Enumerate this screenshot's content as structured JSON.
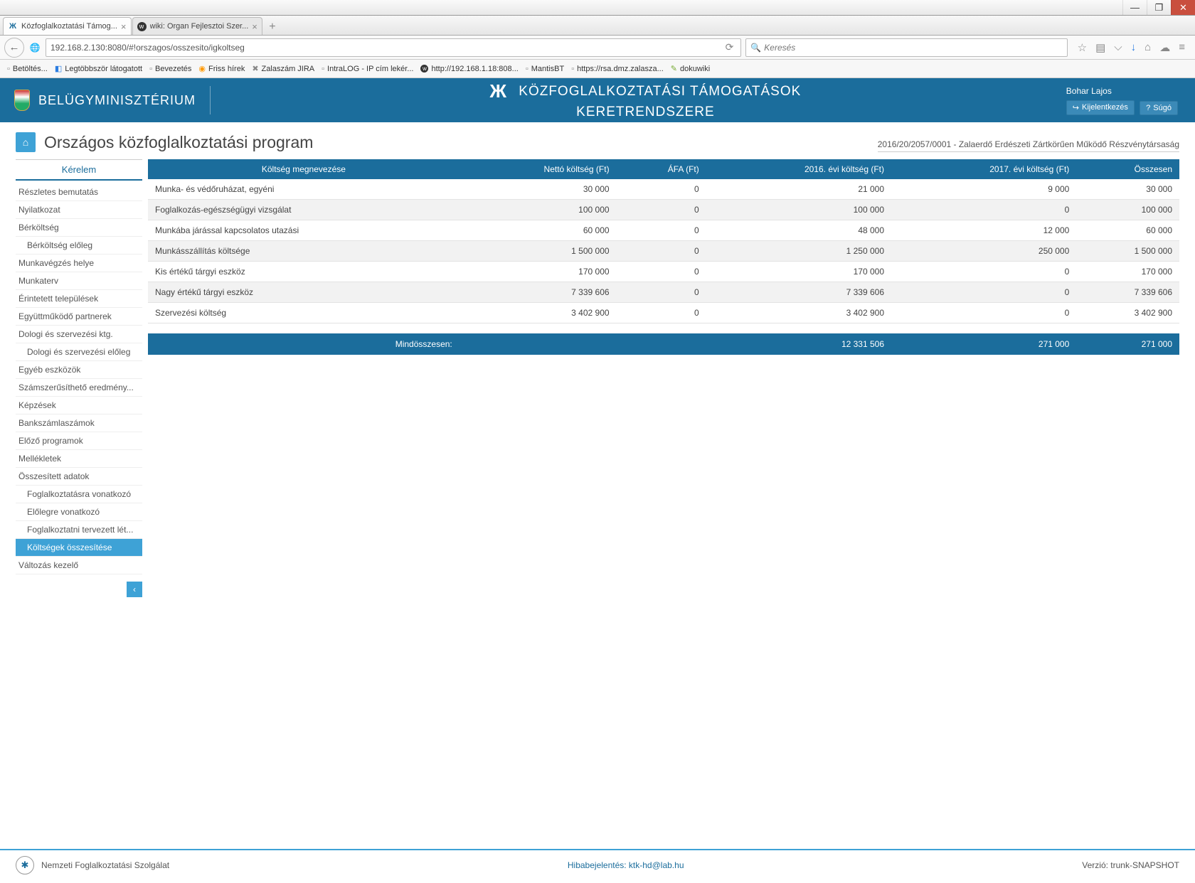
{
  "window": {
    "tabs": [
      {
        "title": "Közfoglalkoztatási Támog...",
        "active": true
      },
      {
        "title": "wiki: Organ Fejlesztoi Szer...",
        "active": false
      }
    ]
  },
  "nav": {
    "url": "192.168.2.130:8080/#!orszagos/osszesito/igkoltseg",
    "search_placeholder": "Keresés"
  },
  "bookmarks": [
    "Betöltés...",
    "Legtöbbször látogatott",
    "Bevezetés",
    "Friss hírek",
    "Zalaszám JIRA",
    "IntraLOG - IP cím lekér...",
    "http://192.168.1.18:808...",
    "MantisBT",
    "https://rsa.dmz.zalasza...",
    "dokuwiki"
  ],
  "header": {
    "ministry": "BELÜGYMINISZTÉRIUM",
    "title_line1": "KÖZFOGLALKOZTATÁSI TÁMOGATÁSOK",
    "title_line2": "KERETRENDSZERE",
    "user": "Bohar Lajos",
    "logout": "Kijelentkezés",
    "help": "Súgó"
  },
  "page": {
    "title": "Országos közfoglalkoztatási program",
    "case": "2016/20/2057/0001 - Zalaerdő Erdészeti Zártkörűen Működő Részvénytársaság"
  },
  "sidebar": {
    "heading": "Kérelem",
    "items": [
      {
        "label": "Részletes bemutatás",
        "indent": false
      },
      {
        "label": "Nyilatkozat",
        "indent": false
      },
      {
        "label": "Bérköltség",
        "indent": false
      },
      {
        "label": "Bérköltség előleg",
        "indent": true
      },
      {
        "label": "Munkavégzés helye",
        "indent": false
      },
      {
        "label": "Munkaterv",
        "indent": false
      },
      {
        "label": "Érintetett települések",
        "indent": false
      },
      {
        "label": "Együttműködő partnerek",
        "indent": false
      },
      {
        "label": "Dologi és szervezési ktg.",
        "indent": false
      },
      {
        "label": "Dologi és szervezési előleg",
        "indent": true
      },
      {
        "label": "Egyéb eszközök",
        "indent": false
      },
      {
        "label": "Számszerűsíthető eredmény...",
        "indent": false
      },
      {
        "label": "Képzések",
        "indent": false
      },
      {
        "label": "Bankszámlaszámok",
        "indent": false
      },
      {
        "label": "Előző programok",
        "indent": false
      },
      {
        "label": "Mellékletek",
        "indent": false
      },
      {
        "label": "Összesített adatok",
        "indent": false
      },
      {
        "label": "Foglalkoztatásra vonatkozó",
        "indent": true
      },
      {
        "label": "Előlegre vonatkozó",
        "indent": true
      },
      {
        "label": "Foglalkoztatni tervezett lét...",
        "indent": true
      },
      {
        "label": "Költségek összesítése",
        "indent": true,
        "active": true
      },
      {
        "label": "Változás kezelő",
        "indent": false
      }
    ]
  },
  "table": {
    "headers": [
      "Költség megnevezése",
      "Nettó költség (Ft)",
      "ÁFA (Ft)",
      "2016. évi költség (Ft)",
      "2017. évi költség (Ft)",
      "Összesen"
    ],
    "rows": [
      [
        "Munka- és védőruházat, egyéni",
        "30 000",
        "0",
        "21 000",
        "9 000",
        "30 000"
      ],
      [
        "Foglalkozás-egészségügyi vizsgálat",
        "100 000",
        "0",
        "100 000",
        "0",
        "100 000"
      ],
      [
        "Munkába járással kapcsolatos utazási",
        "60 000",
        "0",
        "48 000",
        "12 000",
        "60 000"
      ],
      [
        "Munkásszállítás költsége",
        "1 500 000",
        "0",
        "1 250 000",
        "250 000",
        "1 500 000"
      ],
      [
        "Kis értékű tárgyi eszköz",
        "170 000",
        "0",
        "170 000",
        "0",
        "170 000"
      ],
      [
        "Nagy értékű tárgyi eszköz",
        "7 339 606",
        "0",
        "7 339 606",
        "0",
        "7 339 606"
      ],
      [
        "Szervezési költség",
        "3 402 900",
        "0",
        "3 402 900",
        "0",
        "3 402 900"
      ]
    ],
    "footer_label": "Mindösszesen:",
    "footer": [
      "",
      "",
      "12 331 506",
      "271 000",
      "271 000"
    ]
  },
  "footer": {
    "org": "Nemzeti Foglalkoztatási Szolgálat",
    "link": "Hibabejelentés: ktk-hd@lab.hu",
    "version": "Verzió: trunk-SNAPSHOT"
  }
}
